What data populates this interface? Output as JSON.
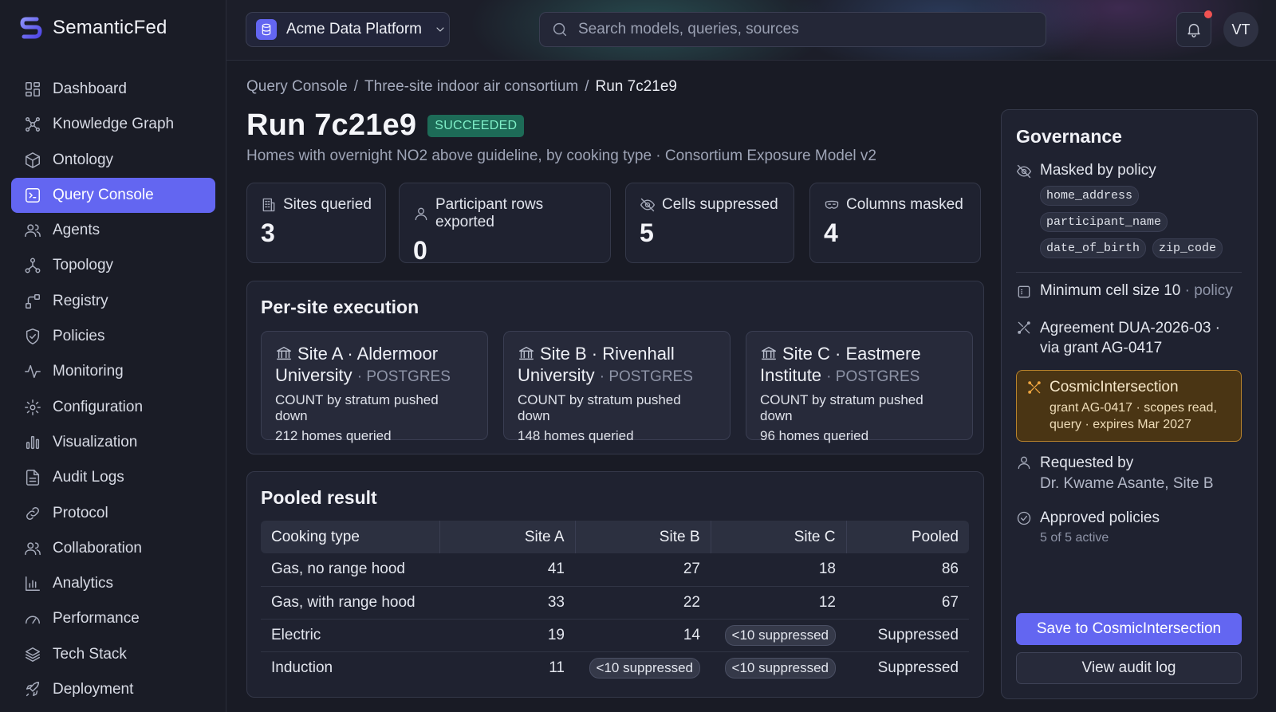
{
  "brand": {
    "name": "SemanticFed"
  },
  "sidebar": {
    "items": [
      {
        "label": "Dashboard"
      },
      {
        "label": "Knowledge Graph"
      },
      {
        "label": "Ontology"
      },
      {
        "label": "Query Console"
      },
      {
        "label": "Agents"
      },
      {
        "label": "Topology"
      },
      {
        "label": "Registry"
      },
      {
        "label": "Policies"
      },
      {
        "label": "Monitoring"
      },
      {
        "label": "Configuration"
      },
      {
        "label": "Visualization"
      },
      {
        "label": "Audit Logs"
      },
      {
        "label": "Protocol"
      },
      {
        "label": "Collaboration"
      },
      {
        "label": "Analytics"
      },
      {
        "label": "Performance"
      },
      {
        "label": "Tech Stack"
      },
      {
        "label": "Deployment"
      }
    ],
    "active": "Query Console"
  },
  "topbar": {
    "workspace": "Acme Data Platform",
    "search_placeholder": "Search models, queries, sources",
    "avatar_initials": "VT"
  },
  "breadcrumb": {
    "items": [
      "Query Console",
      "Three-site indoor air consortium",
      "Run 7c21e9"
    ],
    "separator": "/"
  },
  "run": {
    "title": "Run 7c21e9",
    "status": "SUCCEEDED",
    "subtitle": "Homes with overnight NO2 above guideline, by cooking type · Consortium Exposure Model v2"
  },
  "stats": [
    {
      "label": "Sites queried",
      "value": "3"
    },
    {
      "label": "Participant rows exported",
      "value": "0"
    },
    {
      "label": "Cells suppressed",
      "value": "5"
    },
    {
      "label": "Columns masked",
      "value": "4"
    }
  ],
  "per_site": {
    "title": "Per-site execution",
    "sites": [
      {
        "name": "Site A · Aldermoor University",
        "db": "POSTGRES",
        "pushdown": "COUNT by stratum pushed down",
        "homes": "212 homes queried"
      },
      {
        "name": "Site B · Rivenhall University",
        "db": "POSTGRES",
        "pushdown": "COUNT by stratum pushed down",
        "homes": "148 homes queried"
      },
      {
        "name": "Site C · Eastmere Institute",
        "db": "POSTGRES",
        "pushdown": "COUNT by stratum pushed down",
        "homes": "96 homes queried"
      }
    ]
  },
  "pooled": {
    "title": "Pooled result",
    "columns": [
      "Cooking type",
      "Site A",
      "Site B",
      "Site C",
      "Pooled"
    ],
    "rows": [
      [
        "Gas, no range hood",
        "41",
        "27",
        "18",
        "86"
      ],
      [
        "Gas, with range hood",
        "33",
        "22",
        "12",
        "67"
      ],
      [
        "Electric",
        "19",
        "14",
        "<10 suppressed",
        "Suppressed"
      ],
      [
        "Induction",
        "11",
        "<10 suppressed",
        "<10 suppressed",
        "Suppressed"
      ]
    ],
    "pill_value": "<10 suppressed"
  },
  "governance": {
    "title": "Governance",
    "masked_label": "Masked by policy",
    "masked_columns": [
      "home_address",
      "participant_name",
      "date_of_birth",
      "zip_code"
    ],
    "min_cell": "Minimum cell size 10",
    "min_cell_suffix": "· policy",
    "agreement_line1": "Agreement DUA-2026-03 ·",
    "agreement_line2": "via grant AG-0417",
    "grant": {
      "title": "CosmicIntersection",
      "line1": "grant AG-0417 · scopes read,",
      "line2": "query · expires Mar 2027"
    },
    "requested_label": "Requested by",
    "requested_by": "Dr. Kwame Asante, Site B",
    "approved_label": "Approved policies",
    "approved_count": "5 of 5 active",
    "save_button": "Save to CosmicIntersection",
    "audit_button": "View audit log"
  },
  "colors": {
    "accent": "#6366f1",
    "success_bg": "#1d6b57",
    "success_text": "#7ff0c8",
    "grant_border": "#b8832c",
    "notification": "#f05252"
  }
}
